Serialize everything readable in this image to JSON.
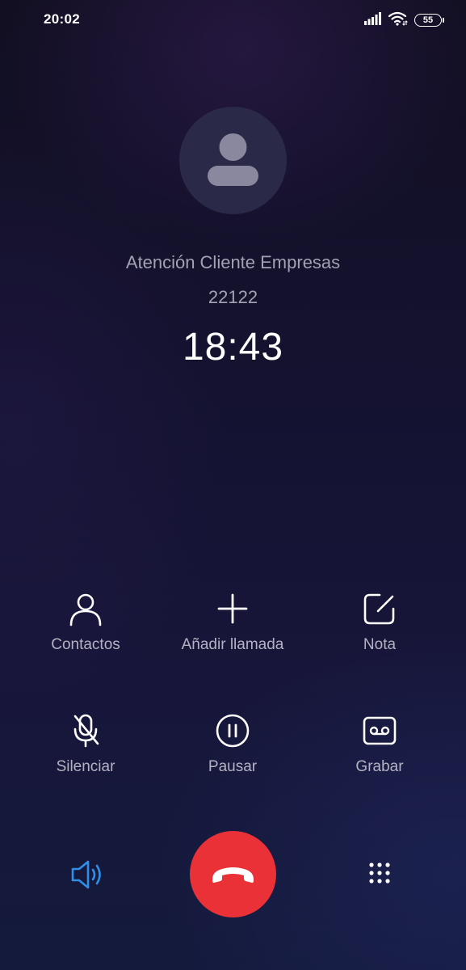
{
  "status_bar": {
    "time": "20:02",
    "battery_level": "55",
    "icons": [
      "signal-icon",
      "wifi-icon",
      "battery-icon"
    ]
  },
  "caller": {
    "avatar_icon": "person-placeholder-icon",
    "name": "Atención Cliente Empresas",
    "number": "22122",
    "duration": "18:43"
  },
  "actions": {
    "contacts": {
      "label": "Contactos",
      "icon": "person-outline-icon"
    },
    "add_call": {
      "label": "Añadir llamada",
      "icon": "plus-icon"
    },
    "note": {
      "label": "Nota",
      "icon": "note-edit-icon"
    },
    "mute": {
      "label": "Silenciar",
      "icon": "mic-off-icon"
    },
    "hold": {
      "label": "Pausar",
      "icon": "pause-icon"
    },
    "record": {
      "label": "Grabar",
      "icon": "cassette-icon"
    }
  },
  "controls": {
    "speaker_icon": "speaker-icon",
    "end_call_icon": "phone-hangup-icon",
    "dialpad_icon": "dialpad-icon"
  },
  "colors": {
    "end_call": "#ea3137",
    "speaker_active": "#2f8ee8",
    "label_text": "#b4b2c2",
    "caller_text": "#a3a1b3"
  }
}
